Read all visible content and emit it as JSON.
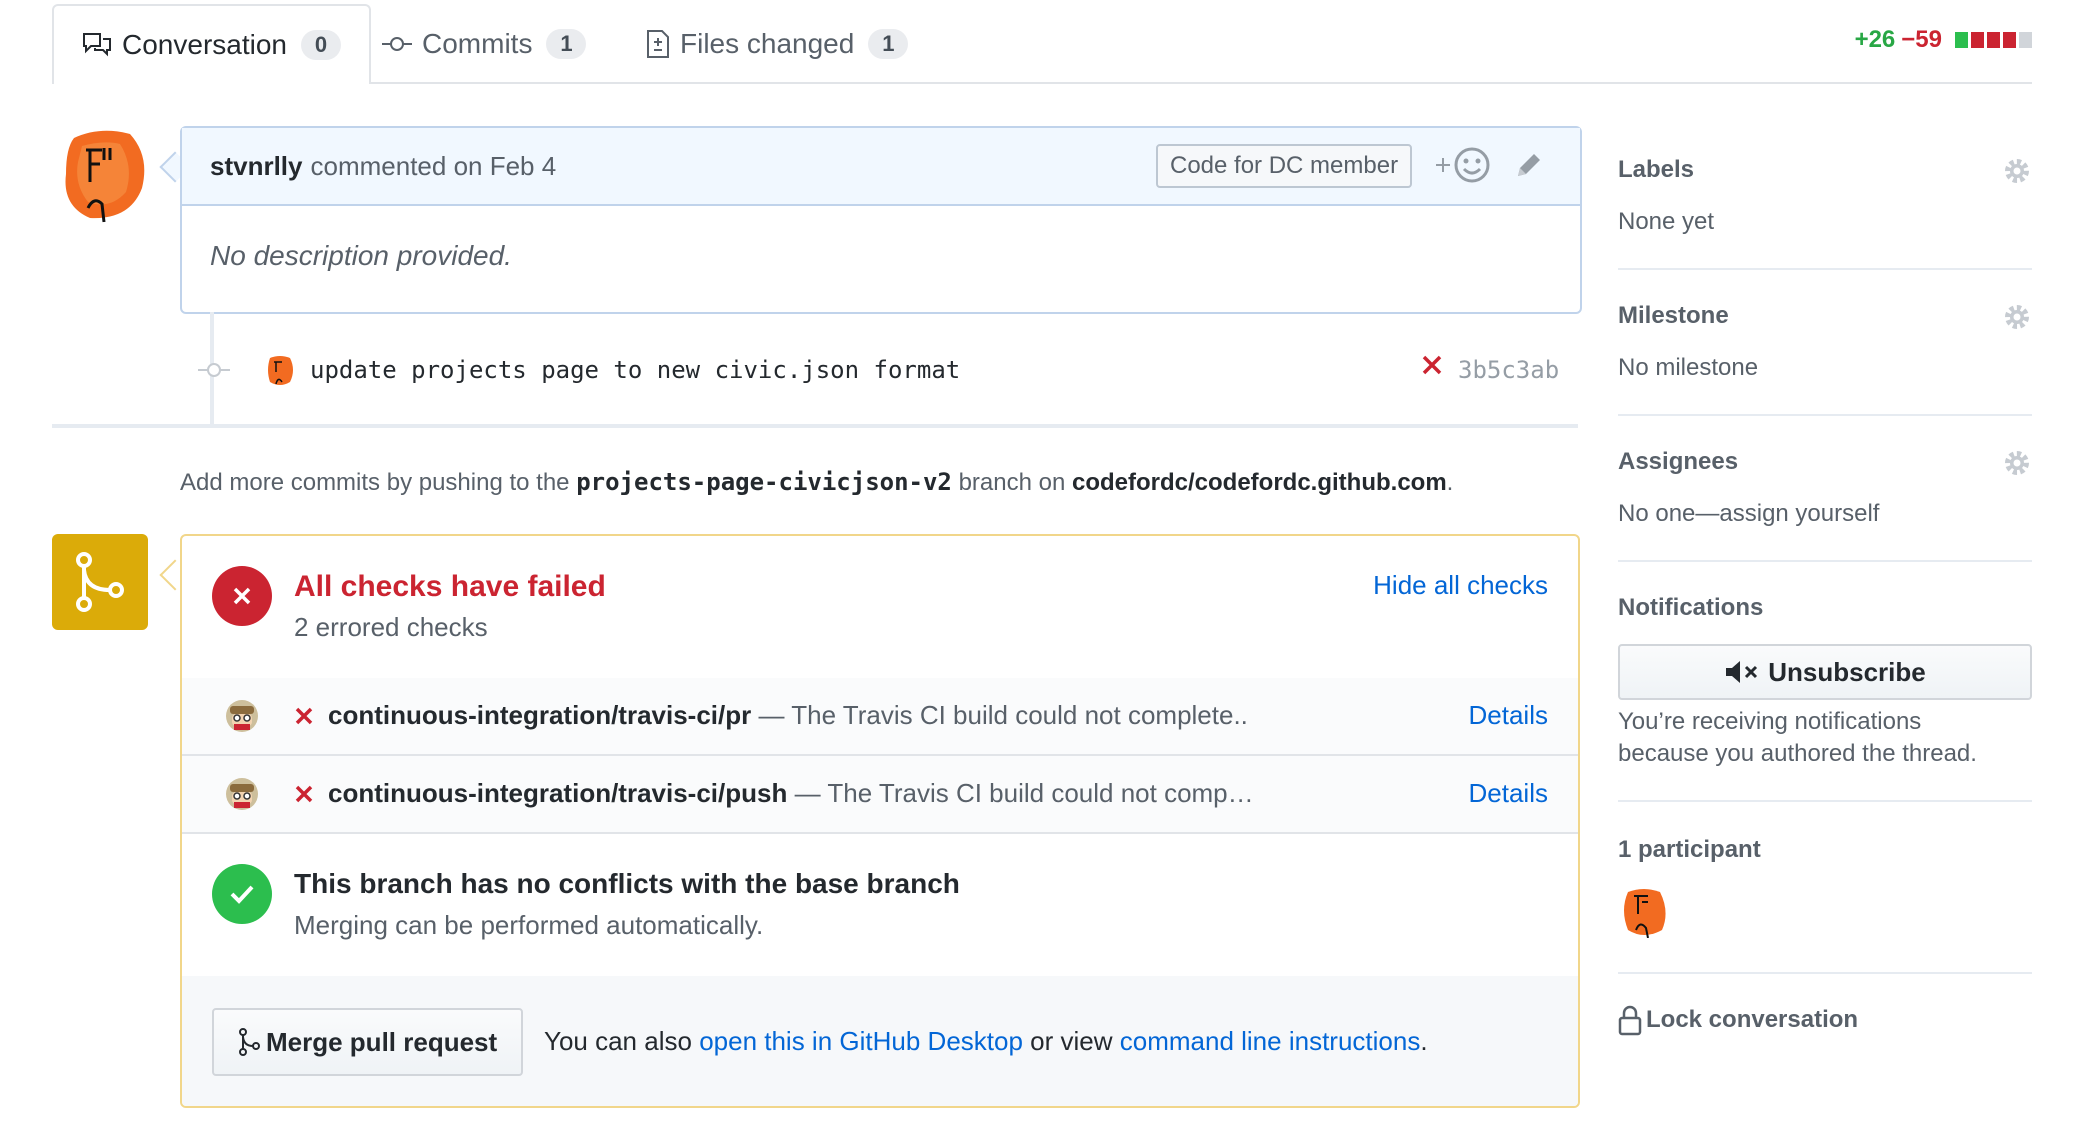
{
  "tabs": [
    {
      "label": "Conversation",
      "count": "0",
      "icon": "comment-discussion-icon"
    },
    {
      "label": "Commits",
      "count": "1",
      "icon": "git-commit-icon"
    },
    {
      "label": "Files changed",
      "count": "1",
      "icon": "file-diff-icon"
    }
  ],
  "diffstat": {
    "additions": "+26",
    "deletions": "−59"
  },
  "comment": {
    "author": "stvnrlly",
    "action": "commented on Feb 4",
    "badge": "Code for DC member",
    "body": "No description provided."
  },
  "commit": {
    "message": "update projects page to new civic.json format",
    "sha": "3b5c3ab"
  },
  "push_hint": {
    "prefix": "Add more commits by pushing to the",
    "branch": "projects-page-civicjson-v2",
    "middle": "branch on",
    "repo": "codefordc/codefordc.github.com",
    "suffix": "."
  },
  "checks": {
    "title": "All checks have failed",
    "subtitle": "2 errored checks",
    "toggle": "Hide all checks",
    "items": [
      {
        "name": "continuous-integration/travis-ci/pr",
        "desc": "— The Travis CI build could not complete..",
        "details": "Details"
      },
      {
        "name": "continuous-integration/travis-ci/push",
        "desc": "— The Travis CI build could not comp…",
        "details": "Details"
      }
    ]
  },
  "conflicts": {
    "title": "This branch has no conflicts with the base branch",
    "subtitle": "Merging can be performed automatically."
  },
  "merge": {
    "button": "Merge pull request",
    "alt_prefix": "You can also",
    "desktop_link": "open this in GitHub Desktop",
    "alt_middle": "or view",
    "cli_link": "command line instructions",
    "alt_suffix": "."
  },
  "sidebar": {
    "labels": {
      "heading": "Labels",
      "value": "None yet"
    },
    "milestone": {
      "heading": "Milestone",
      "value": "No milestone"
    },
    "assignees": {
      "heading": "Assignees",
      "value": "No one—assign yourself"
    },
    "notifications": {
      "heading": "Notifications",
      "button": "Unsubscribe",
      "reason_line1": "You’re receiving notifications",
      "reason_line2": "because you authored the thread."
    },
    "participants": {
      "heading": "1 participant"
    },
    "lock": "Lock conversation"
  },
  "colors": {
    "added": "#28a745",
    "deleted": "#cb2431",
    "pending": "#dbab09",
    "success": "#2cbe4e",
    "link": "#0366d6"
  }
}
